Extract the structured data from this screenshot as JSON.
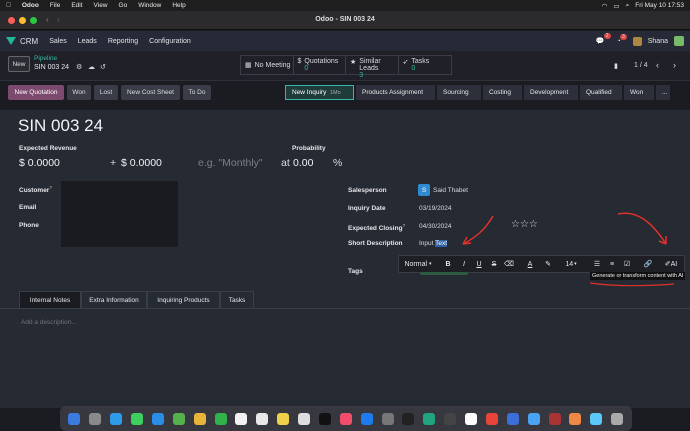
{
  "macos": {
    "app": "Odoo",
    "menus": [
      "File",
      "Edit",
      "View",
      "Go",
      "Window",
      "Help"
    ],
    "window_title": "Odoo - SIN 003 24",
    "clock": "Fri May 10  17:53"
  },
  "nav": {
    "app_name": "CRM",
    "items": [
      "Sales",
      "Leads",
      "Reporting",
      "Configuration"
    ],
    "chat_badge": "2",
    "activity_badge": "3",
    "user": "Shana"
  },
  "control": {
    "new_label": "New",
    "breadcrumb_parent": "Pipeline",
    "record_name": "SIN 003 24",
    "smart_buttons": {
      "meeting": "No Meeting",
      "quotations_label": "Quotations",
      "quotations_count": "0",
      "similar_label": "Similar Leads",
      "similar_count": "3",
      "tasks_label": "Tasks",
      "tasks_count": "0"
    },
    "pager": "1 / 4"
  },
  "actions": [
    "New Quotation",
    "Won",
    "Lost",
    "New Cost Sheet",
    "To Do"
  ],
  "stages": {
    "current": "New Inquiry",
    "current_duration": "1Mo",
    "others": [
      "Products Assignment",
      "Sourcing",
      "Costing",
      "Development",
      "Qualified",
      "Won"
    ],
    "more": "..."
  },
  "form": {
    "title": "SIN 003 24",
    "expected_revenue_label": "Expected Revenue",
    "expected_revenue": "$ 0.0000",
    "plus": "+",
    "recurring": "$ 0.0000",
    "recurring_placeholder": "e.g. \"Monthly\"",
    "at": "at",
    "probability_label": "Probability",
    "probability": "0.00",
    "percent": "%",
    "customer_label": "Customer",
    "customer_help": "?",
    "email_label": "Email",
    "phone_label": "Phone",
    "salesperson_label": "Salesperson",
    "salesperson_initial": "S",
    "salesperson": "Said Thabet",
    "inquiry_date_label": "Inquiry Date",
    "inquiry_date": "03/19/2024",
    "expected_closing_label": "Expected Closing",
    "expected_closing_help": "?",
    "expected_closing": "04/30/2024",
    "stars": "☆☆☆",
    "short_desc_label": "Short Description",
    "short_desc_prefix": "Input ",
    "short_desc_selected": "Text",
    "tags_label": "Tags"
  },
  "toolbar": {
    "style": "Normal",
    "bold": "B",
    "italic": "I",
    "underline": "U",
    "strike": "S",
    "font_size": "14",
    "ai_label": "AI",
    "tooltip": "Generate or transform content with AI"
  },
  "tabs": [
    "Internal Notes",
    "Extra Information",
    "Inquiring Products",
    "Tasks"
  ],
  "notes_placeholder": "Add a description..."
}
